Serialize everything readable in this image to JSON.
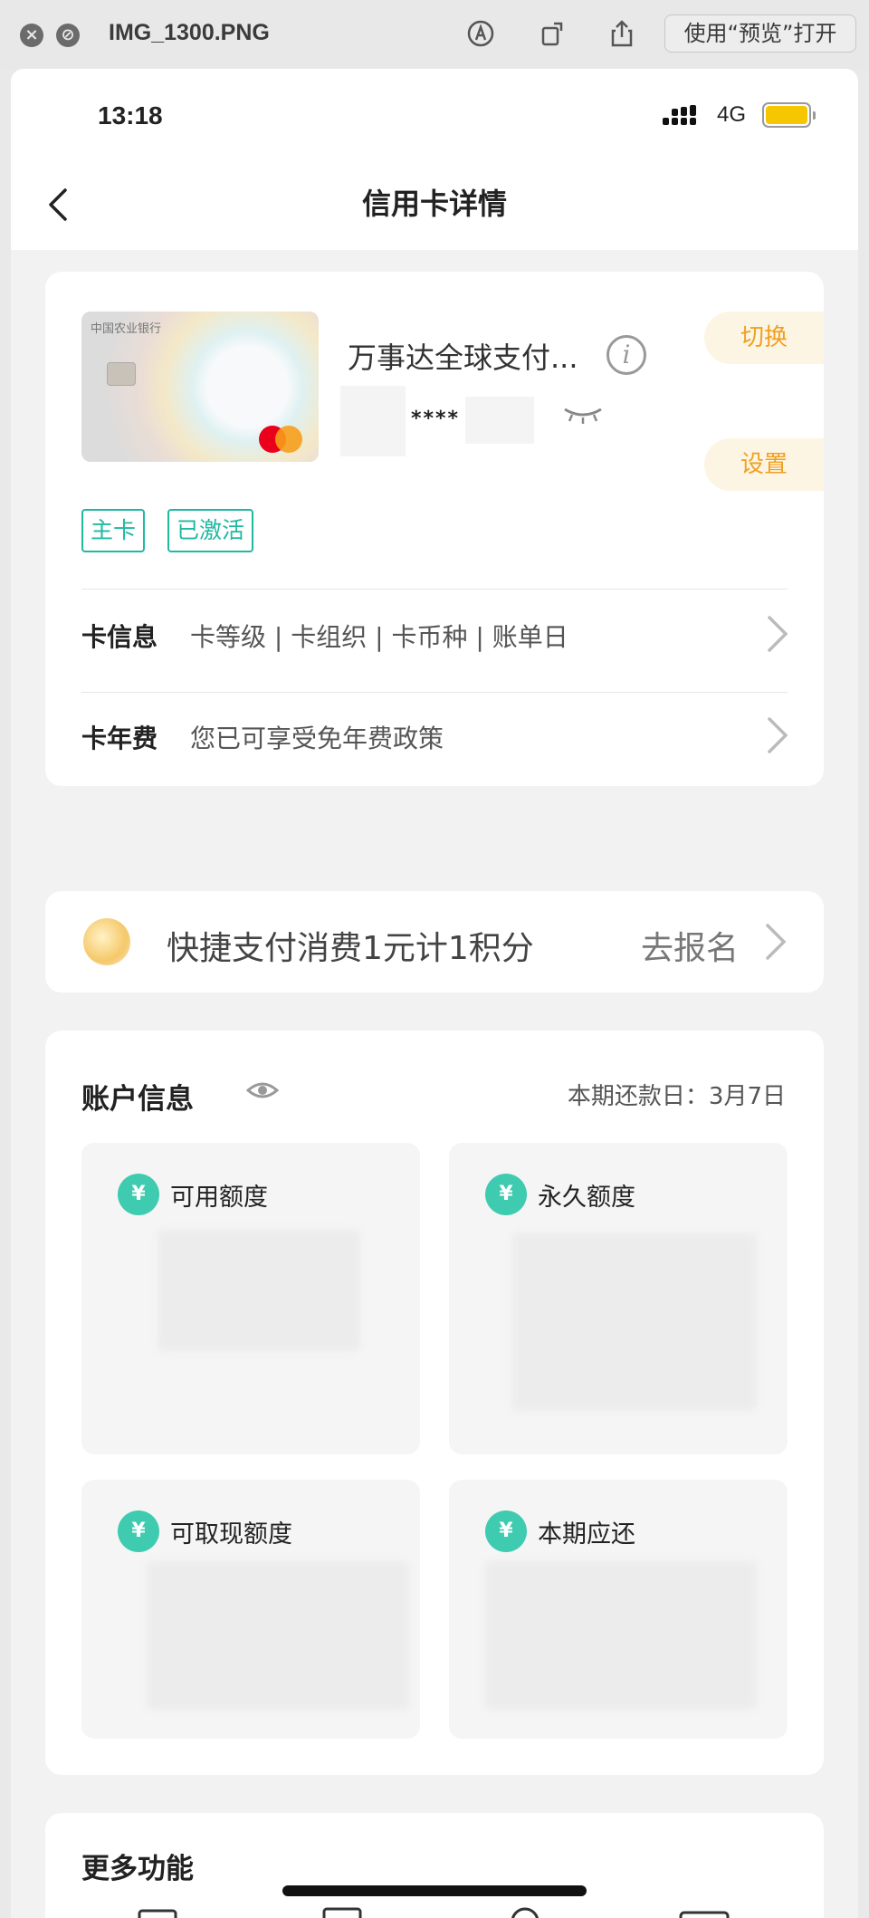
{
  "window": {
    "file_name": "IMG_1300.PNG",
    "open_with_label": "使用“预览”打开",
    "close_icon": "close-icon",
    "stop_icon": "block-icon"
  },
  "status_bar": {
    "time": "13:18",
    "network": "4G",
    "battery_color": "#f6c600"
  },
  "nav": {
    "title": "信用卡详情"
  },
  "card": {
    "bank_name": "中国农业银行",
    "title": "万事达全球支付...",
    "masked_number": "****",
    "switch_label": "切换",
    "settings_label": "设置",
    "tags": [
      "主卡",
      "已激活"
    ],
    "rows": [
      {
        "label": "卡信息",
        "value": "卡等级 | 卡组织 | 卡币种 | 账单日"
      },
      {
        "label": "卡年费",
        "value": "您已可享受免年费政策"
      }
    ]
  },
  "promo": {
    "text": "快捷支付消费1元计1积分",
    "action": "去报名"
  },
  "account": {
    "title": "账户信息",
    "due_date": "本期还款日：3月7日",
    "tiles": [
      {
        "label": "可用额度",
        "icon": "money-bag-icon"
      },
      {
        "label": "永久额度",
        "icon": "money-bag-icon"
      },
      {
        "label": "可取现额度",
        "icon": "money-bag-icon"
      },
      {
        "label": "本期应还",
        "icon": "money-bag-icon"
      }
    ]
  },
  "more": {
    "title": "更多功能"
  },
  "colors": {
    "accent_teal": "#1fb9a0",
    "accent_orange": "#f0a020"
  }
}
